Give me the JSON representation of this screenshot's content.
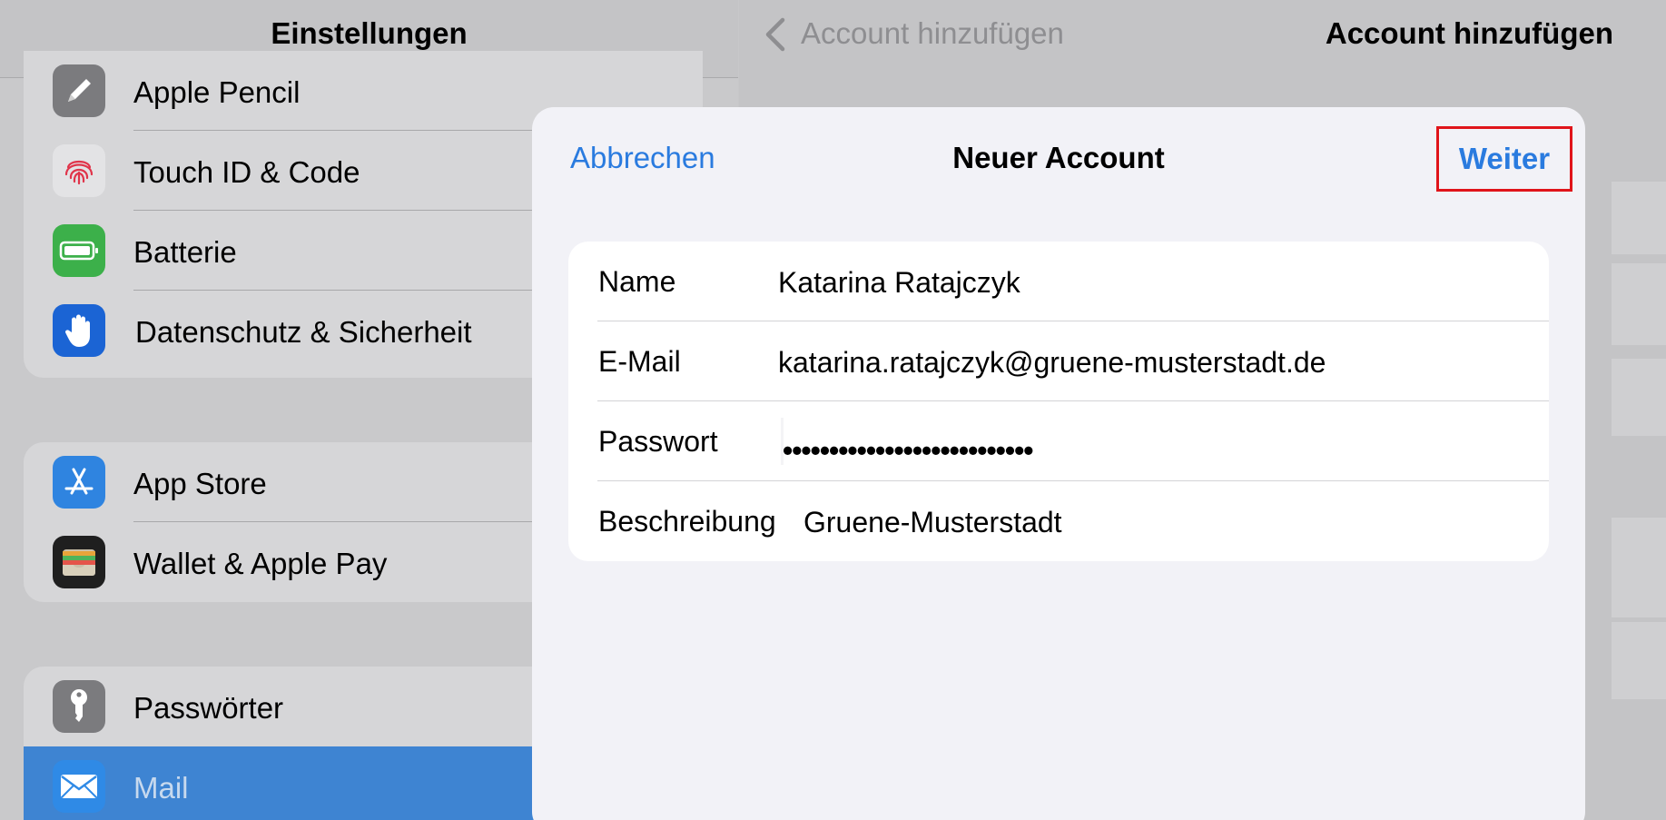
{
  "sidebar": {
    "title": "Einstellungen",
    "group1": [
      {
        "label": "Apple Pencil",
        "icon": "pencil-icon",
        "color": "#7b7b7e"
      },
      {
        "label": "Touch ID & Code",
        "icon": "fingerprint-icon",
        "color": "#d9d9db"
      },
      {
        "label": "Batterie",
        "icon": "battery-icon",
        "color": "#3cb04a"
      },
      {
        "label": "Datenschutz & Sicherheit",
        "icon": "hand-icon",
        "color": "#1b64d4"
      }
    ],
    "group2": [
      {
        "label": "App Store",
        "icon": "app-store-icon",
        "color": "#2f84e0"
      },
      {
        "label": "Wallet & Apple Pay",
        "icon": "wallet-icon",
        "color": "#1f1f1f"
      }
    ],
    "group3": [
      {
        "label": "Passwörter",
        "icon": "key-icon",
        "color": "#7b7b7e"
      },
      {
        "label": "Mail",
        "icon": "mail-icon",
        "color": "#2f8ae6",
        "selected": true
      }
    ]
  },
  "detail": {
    "back_label": "Account hinzufügen",
    "title": "Account hinzufügen"
  },
  "modal": {
    "title": "Neuer Account",
    "cancel_label": "Abbrechen",
    "next_label": "Weiter",
    "fields": {
      "name": {
        "label": "Name",
        "value": "Katarina Ratajczyk"
      },
      "email": {
        "label": "E-Mail",
        "value": "katarina.ratajczyk@gruene-musterstadt.de"
      },
      "password": {
        "label": "Passwort",
        "value": "•••••••••••••••••••••••••••"
      },
      "description": {
        "label": "Beschreibung",
        "value": "Gruene-Musterstadt"
      }
    }
  },
  "colors": {
    "accent": "#2a7bdf",
    "highlight_box": "#e0141a",
    "selected_row": "#3e84d2"
  }
}
